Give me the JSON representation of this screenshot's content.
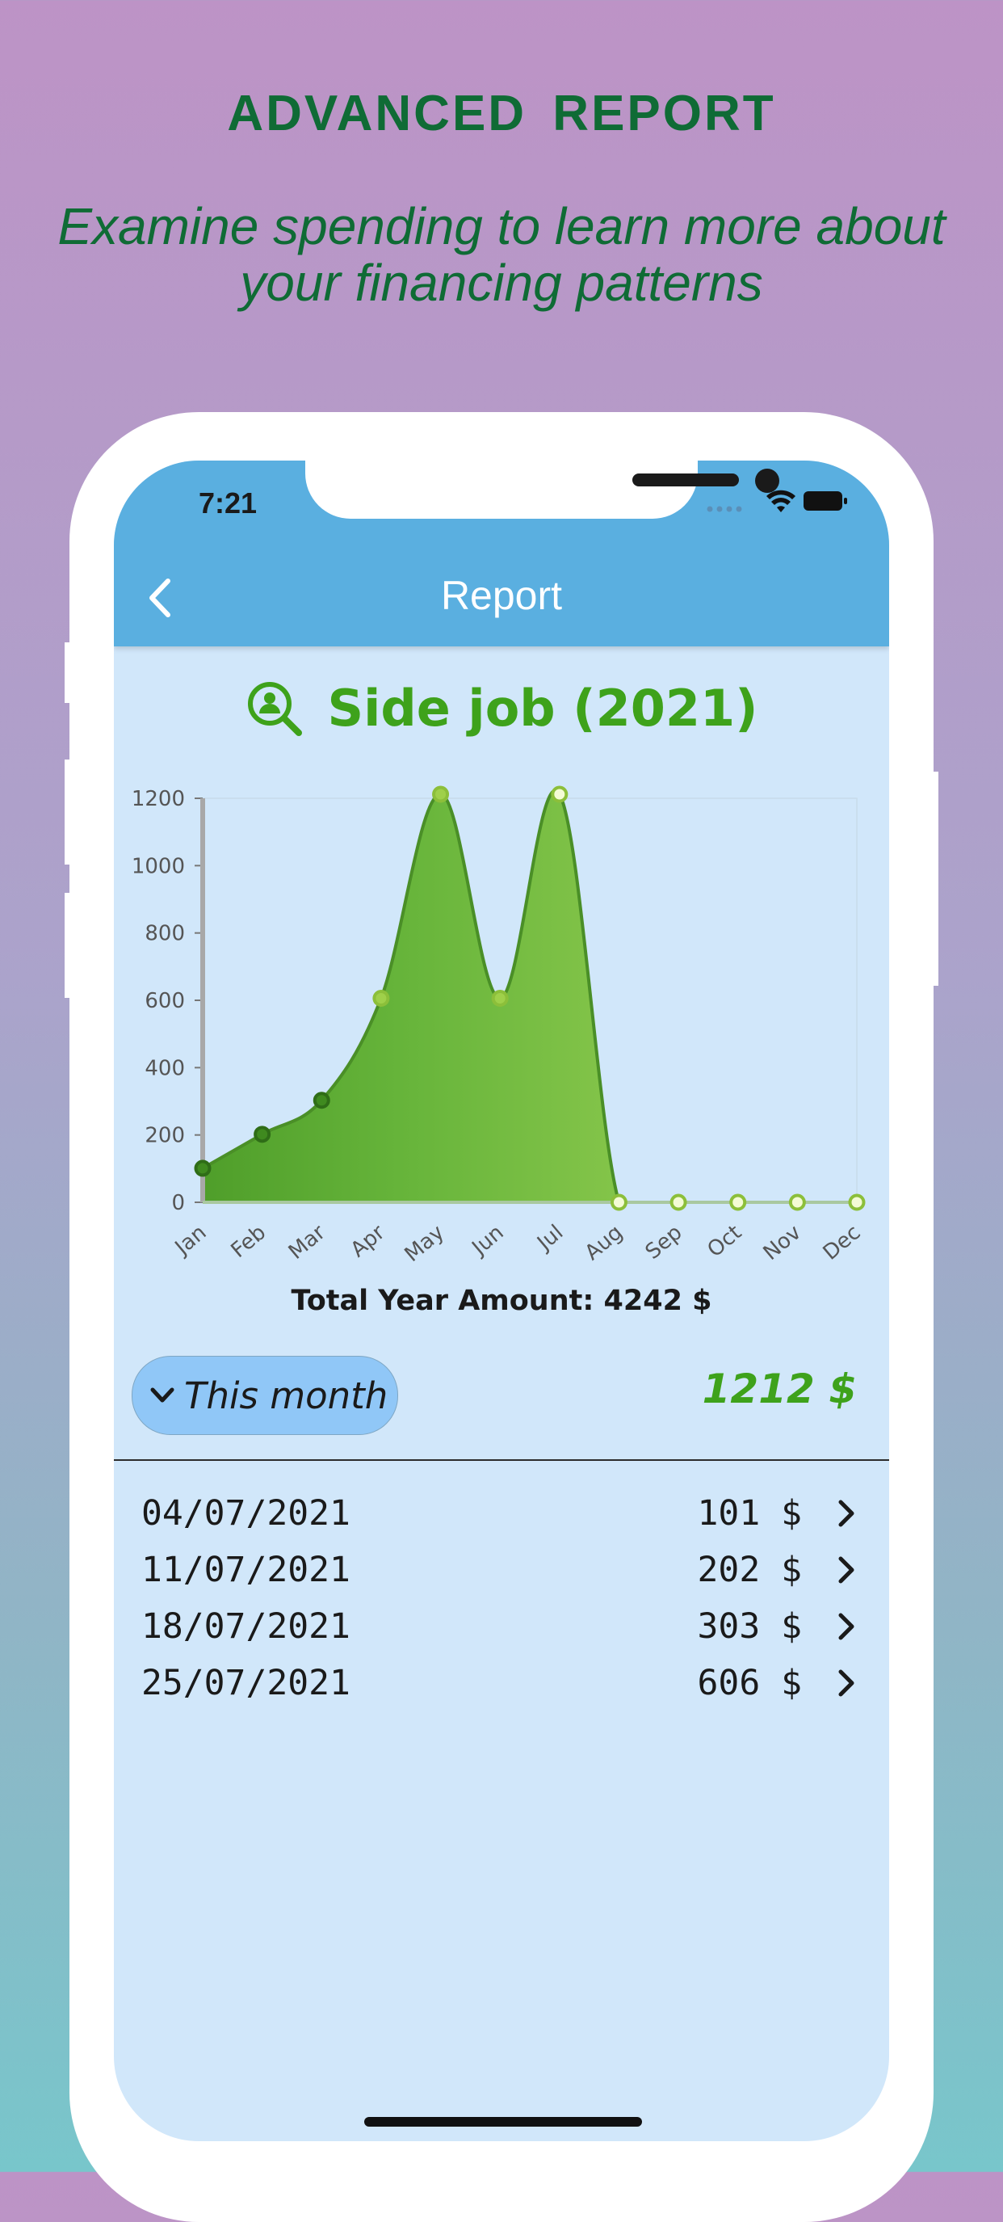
{
  "promo": {
    "title": "ADVANCED  REPORT",
    "subtitle": "Examine spending to learn more about your financing patterns"
  },
  "status_bar": {
    "time": "7:21"
  },
  "app_bar": {
    "title": "Report",
    "back_icon": "chevron-left-icon"
  },
  "report": {
    "title": "Side job (2021)",
    "title_icon": "person-search-icon",
    "total_label": "Total Year Amount: 4242 $",
    "period_selector": "This month",
    "period_amount": "1212 $"
  },
  "chart_data": {
    "type": "area",
    "categories": [
      "Jan",
      "Feb",
      "Mar",
      "Apr",
      "May",
      "Jun",
      "Jul",
      "Aug",
      "Sep",
      "Oct",
      "Nov",
      "Dec"
    ],
    "values": [
      101,
      202,
      303,
      606,
      1212,
      606,
      1212,
      0,
      0,
      0,
      0,
      0
    ],
    "yticks": [
      "0",
      "200",
      "400",
      "600",
      "800",
      "1000",
      "1200"
    ],
    "ylim": [
      0,
      1200
    ],
    "colors": {
      "fill_start": "#4f9e2a",
      "fill_end": "#a4d65a",
      "line": "#4a8f27",
      "point_fill": "#3f8a1f",
      "point_fill_light": "#d9f07a"
    },
    "grid": false,
    "legend": "none"
  },
  "transactions": [
    {
      "date": "04/07/2021",
      "amount": "101 $"
    },
    {
      "date": "11/07/2021",
      "amount": "202 $"
    },
    {
      "date": "18/07/2021",
      "amount": "303 $"
    },
    {
      "date": "25/07/2021",
      "amount": "606 $"
    }
  ]
}
